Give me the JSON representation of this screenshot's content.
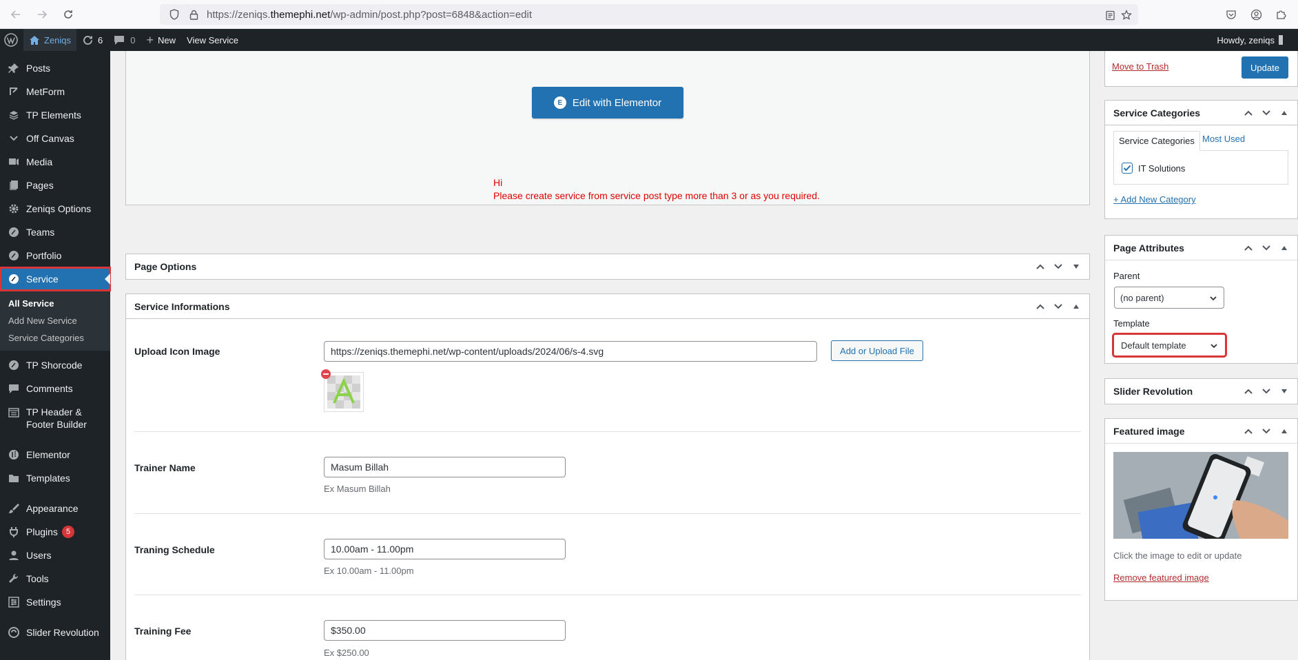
{
  "browser": {
    "url_prefix": "https://zeniqs.",
    "url_domain": "themephi.net",
    "url_path": "/wp-admin/post.php?post=6848&action=edit"
  },
  "adminbar": {
    "site_name": "Zeniqs",
    "updates_count": "6",
    "comments_count": "0",
    "new_label": "New",
    "view_label": "View Service",
    "howdy": "Howdy, zeniqs"
  },
  "menu": {
    "items_top": [
      {
        "label": "Posts",
        "icon": "pin-icon"
      },
      {
        "label": "MetForm",
        "icon": "form-icon"
      },
      {
        "label": "TP Elements",
        "icon": "layers-icon"
      },
      {
        "label": "Off Canvas",
        "icon": "chevron-icon"
      },
      {
        "label": "Media",
        "icon": "media-icon"
      },
      {
        "label": "Pages",
        "icon": "pages-icon"
      },
      {
        "label": "Zeniqs Options",
        "icon": "gear-icon"
      },
      {
        "label": "Teams",
        "icon": "circle-icon"
      },
      {
        "label": "Portfolio",
        "icon": "circle-icon"
      }
    ],
    "current": {
      "label": "Service",
      "icon": "circle-icon"
    },
    "submenu": [
      "All Service",
      "Add New Service",
      "Service Categories"
    ],
    "items_bottom": [
      {
        "label": "TP Shorcode",
        "icon": "circle-icon"
      },
      {
        "label": "Comments",
        "icon": "comment-icon"
      }
    ],
    "builder_label_1": "TP Header &",
    "builder_label_2": "Footer Builder",
    "items_bottom2": [
      {
        "label": "Elementor",
        "icon": "elementor-icon"
      },
      {
        "label": "Templates",
        "icon": "folder-icon"
      }
    ],
    "items_bottom3": [
      {
        "label": "Appearance",
        "icon": "brush-icon"
      },
      {
        "label": "Plugins",
        "icon": "plug-icon",
        "badge": "5"
      },
      {
        "label": "Users",
        "icon": "user-icon"
      },
      {
        "label": "Tools",
        "icon": "wrench-icon"
      },
      {
        "label": "Settings",
        "icon": "settings-icon"
      }
    ],
    "slider_label": "Slider Revolution"
  },
  "editor": {
    "elementor_button": "Edit with Elementor",
    "msg_line1": "Hi",
    "msg_line2": "Please create service from service post type more than 3 or as you required."
  },
  "page_options": {
    "title": "Page Options"
  },
  "service_info": {
    "title": "Service Informations",
    "upload_label": "Upload Icon Image",
    "upload_value": "https://zeniqs.themephi.net/wp-content/uploads/2024/06/s-4.svg",
    "upload_button": "Add or Upload File",
    "trainer_label": "Trainer Name",
    "trainer_value": "Masum Billah",
    "trainer_hint": "Ex Masum Billah",
    "schedule_label": "Traning Schedule",
    "schedule_value": "10.00am - 11.00pm",
    "schedule_hint": "Ex 10.00am - 11.00pm",
    "fee_label": "Training Fee",
    "fee_value": "$350.00",
    "fee_hint": "Ex $250.00"
  },
  "sidebar": {
    "trash_link": "Move to Trash",
    "update_button": "Update",
    "categories": {
      "title": "Service Categories",
      "tab_all": "Service Categories",
      "tab_used": "Most Used",
      "item": "IT Solutions",
      "item_checked": true,
      "add_link": "+ Add New Category"
    },
    "attributes": {
      "title": "Page Attributes",
      "parent_label": "Parent",
      "parent_value": "(no parent)",
      "template_label": "Template",
      "template_value": "Default template"
    },
    "slider": {
      "title": "Slider Revolution"
    },
    "featured": {
      "title": "Featured image",
      "hint": "Click the image to edit or update",
      "remove_link": "Remove featured image"
    }
  },
  "colors": {
    "admin_dark": "#1d2327",
    "wp_blue": "#2271b1",
    "highlight_red": "#d63638",
    "message_red": "#e00000"
  }
}
